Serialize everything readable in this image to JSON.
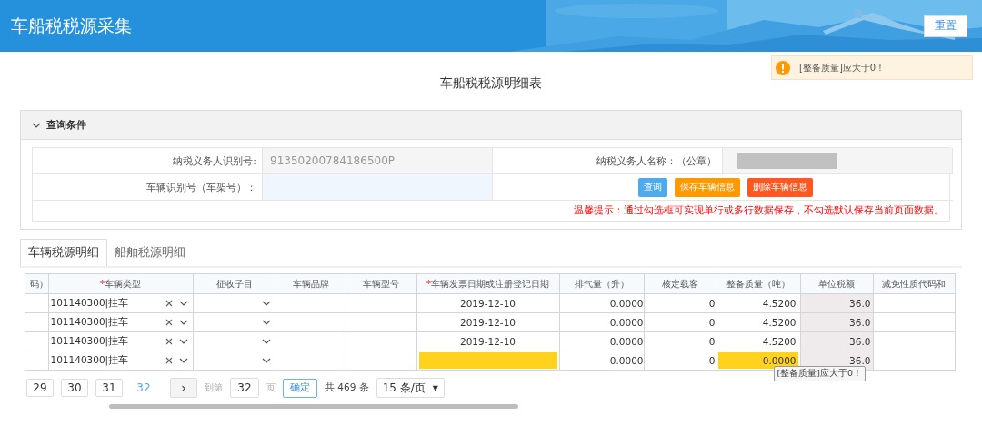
{
  "header": {
    "title": "车船税税源采集",
    "reset_button": "重置"
  },
  "toast": {
    "message": "[整备质量]应大于0！"
  },
  "page_title": "车船税税源明细表",
  "query_panel": {
    "title": "查询条件",
    "expanded": true,
    "taxpayer_id_label": "纳税义务人识别号:",
    "taxpayer_id_value": "91350200784186500P",
    "taxpayer_name_label": "纳税义务人名称：（公章）",
    "vin_label": "车辆识别号（车架号）：",
    "buttons": [
      {
        "label": "查询",
        "kind": "primary"
      },
      {
        "label": "保存车辆信息",
        "kind": "warning"
      },
      {
        "label": "删除车辆信息",
        "kind": "danger"
      }
    ],
    "hint": "温馨提示：通过勾选框可实现单行或多行数据保存，不勾选默认保存当前页面数据。"
  },
  "tabs": [
    {
      "label": "车辆税源明细",
      "selected": true
    },
    {
      "label": "船舶税源明细",
      "selected": false
    }
  ],
  "table": {
    "columns": [
      {
        "label": "码）"
      },
      {
        "label": "车辆类型",
        "required_mark": "*"
      },
      {
        "label": "征收子目"
      },
      {
        "label": "车辆品牌"
      },
      {
        "label": "车辆型号"
      },
      {
        "label": "车辆发票日期或注册登记日期",
        "required_mark": "*"
      },
      {
        "label": "排气量（升）"
      },
      {
        "label": "核定载客"
      },
      {
        "label": "整备质量（吨）"
      },
      {
        "label": "单位税额"
      },
      {
        "label": "减免性质代码和"
      }
    ],
    "rows": [
      {
        "vehicle_type": "101140300|挂车",
        "date": "2019-12-10",
        "date_invalid": false,
        "displacement": "0.0000",
        "seats": "0",
        "curb_mass": "4.5200",
        "mass_invalid": false,
        "unit_tax": "36.0"
      },
      {
        "vehicle_type": "101140300|挂车",
        "date": "2019-12-10",
        "date_invalid": false,
        "displacement": "0.0000",
        "seats": "0",
        "curb_mass": "4.5200",
        "mass_invalid": false,
        "unit_tax": "36.0"
      },
      {
        "vehicle_type": "101140300|挂车",
        "date": "2019-12-10",
        "date_invalid": false,
        "displacement": "0.0000",
        "seats": "0",
        "curb_mass": "4.5200",
        "mass_invalid": false,
        "unit_tax": "36.0"
      },
      {
        "vehicle_type": "101140300|挂车",
        "date": "",
        "date_invalid": true,
        "displacement": "0.0000",
        "seats": "0",
        "curb_mass": "0.0000",
        "mass_invalid": true,
        "unit_tax": "36.0"
      }
    ],
    "tooltip": "[整备质量]应大于0！"
  },
  "pagination": {
    "pages": [
      {
        "label": "29",
        "selected": false
      },
      {
        "label": "30",
        "selected": false
      },
      {
        "label": "31",
        "selected": false
      },
      {
        "label": "32",
        "selected": true
      }
    ],
    "next": "›",
    "goto_label": "到第",
    "goto_value": "32",
    "page_unit": "页",
    "confirm": "确定",
    "total": "共 469 条",
    "page_size": "15 条/页",
    "page_size_caret": "▼"
  }
}
